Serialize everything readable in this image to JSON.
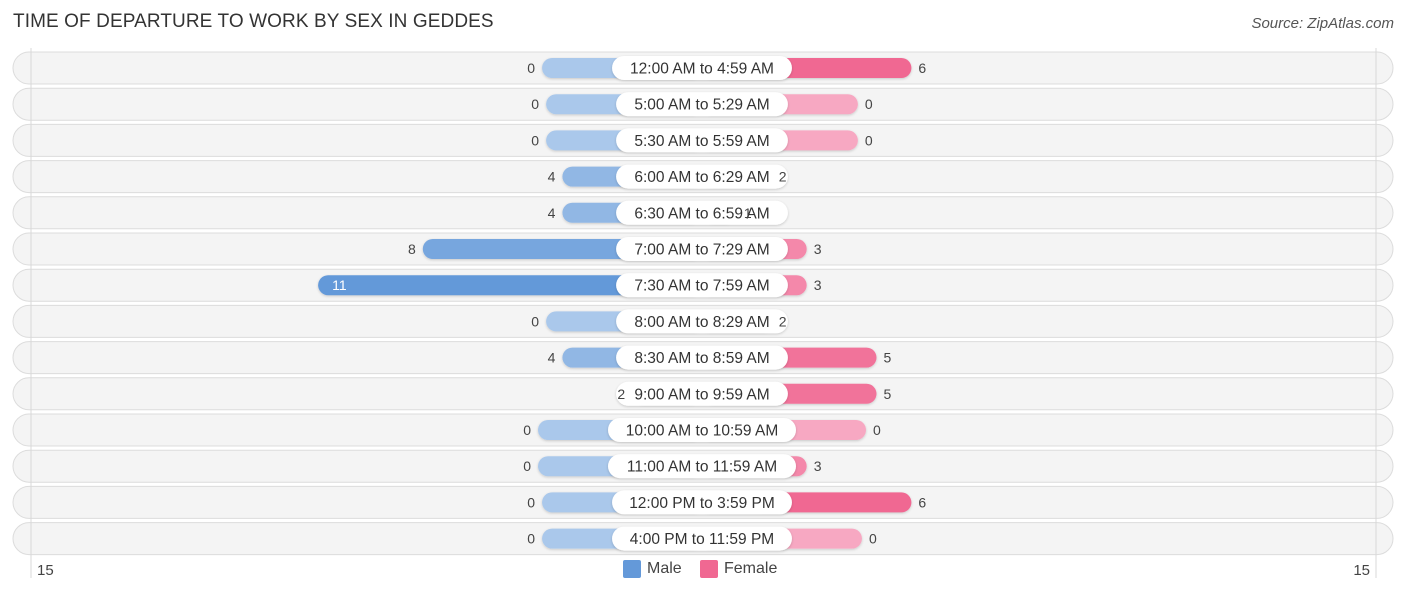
{
  "title": "TIME OF DEPARTURE TO WORK BY SEX IN GEDDES",
  "source": "Source: ZipAtlas.com",
  "colors": {
    "male_strong": "#6499d9",
    "male_light": "#aac8eb",
    "female_strong": "#f06892",
    "female_light": "#f7a8c2",
    "row_bg": "#f4f4f4",
    "row_border": "#dcdcdc"
  },
  "legend": [
    {
      "label": "Male",
      "color": "#6499d9"
    },
    {
      "label": "Female",
      "color": "#f06892"
    }
  ],
  "axis": {
    "left_label": "15",
    "right_label": "15"
  },
  "chart_data": {
    "type": "bar",
    "orientation": "horizontal-diverging",
    "title": "TIME OF DEPARTURE TO WORK BY SEX IN GEDDES",
    "categories": [
      "12:00 AM to 4:59 AM",
      "5:00 AM to 5:29 AM",
      "5:30 AM to 5:59 AM",
      "6:00 AM to 6:29 AM",
      "6:30 AM to 6:59 AM",
      "7:00 AM to 7:29 AM",
      "7:30 AM to 7:59 AM",
      "8:00 AM to 8:29 AM",
      "8:30 AM to 8:59 AM",
      "9:00 AM to 9:59 AM",
      "10:00 AM to 10:59 AM",
      "11:00 AM to 11:59 AM",
      "12:00 PM to 3:59 PM",
      "4:00 PM to 11:59 PM"
    ],
    "series": [
      {
        "name": "Male",
        "values": [
          0,
          0,
          0,
          4,
          4,
          8,
          11,
          0,
          4,
          2,
          0,
          0,
          0,
          0
        ]
      },
      {
        "name": "Female",
        "values": [
          6,
          0,
          0,
          2,
          1,
          3,
          3,
          2,
          5,
          5,
          0,
          3,
          6,
          0
        ]
      }
    ],
    "xlim": [
      -15,
      15
    ],
    "xtick_labels": [
      "15",
      "15"
    ],
    "legend_position": "bottom-center",
    "grid": false
  }
}
